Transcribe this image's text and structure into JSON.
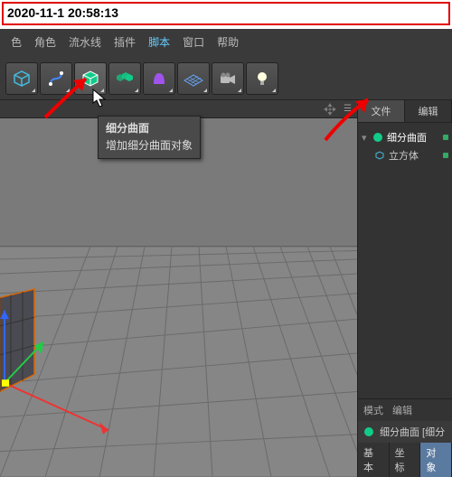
{
  "timestamp": "2020-11-1 20:58:13",
  "menu": {
    "items": [
      "色",
      "角色",
      "流水线",
      "插件",
      "脚本",
      "窗口",
      "帮助"
    ],
    "active_index": 4
  },
  "toolbar": {
    "tools": [
      {
        "name": "cube-icon"
      },
      {
        "name": "pen-icon"
      },
      {
        "name": "subdiv-icon"
      },
      {
        "name": "array-icon"
      },
      {
        "name": "deformer-icon"
      },
      {
        "name": "floor-icon"
      },
      {
        "name": "camera-icon"
      },
      {
        "name": "light-icon"
      }
    ]
  },
  "tooltip": {
    "title": "细分曲面",
    "desc": "增加细分曲面对象"
  },
  "viewport": {
    "nav_icon": "move-all-icon",
    "menu_glyph": "☰"
  },
  "side": {
    "tabs": [
      "文件",
      "编辑"
    ],
    "active_tab": 0,
    "objects": [
      {
        "name": "细分曲面",
        "icon": "subdiv-node-icon",
        "selected": true
      },
      {
        "name": "立方体",
        "icon": "cube-node-icon",
        "child": true
      }
    ]
  },
  "attr": {
    "head": [
      "模式",
      "编辑"
    ],
    "title": "细分曲面 [细分",
    "icon": "subdiv-node-icon",
    "tabs": [
      "基本",
      "坐标",
      "对象"
    ],
    "active_tab": 2
  }
}
